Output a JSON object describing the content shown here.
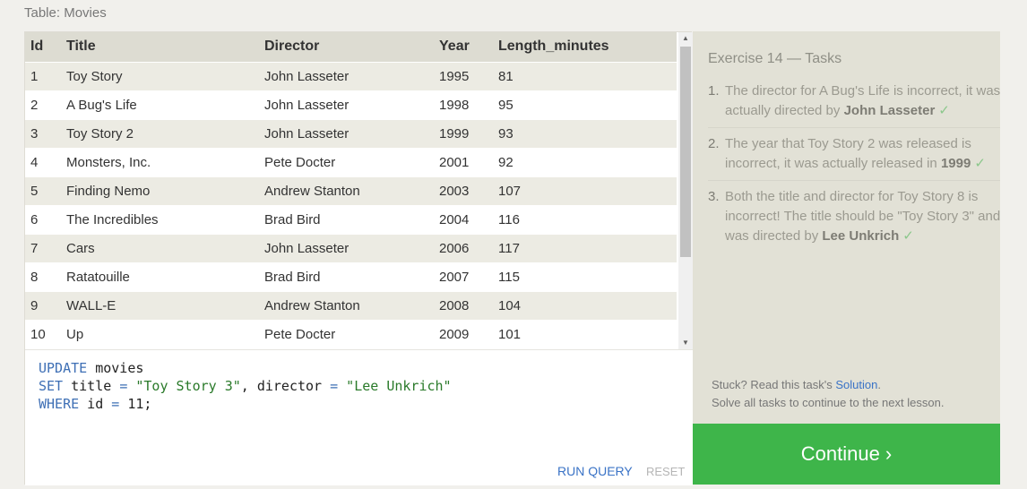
{
  "table_label": "Table: Movies",
  "columns": [
    "Id",
    "Title",
    "Director",
    "Year",
    "Length_minutes"
  ],
  "rows": [
    [
      "1",
      "Toy Story",
      "John Lasseter",
      "1995",
      "81"
    ],
    [
      "2",
      "A Bug's Life",
      "John Lasseter",
      "1998",
      "95"
    ],
    [
      "3",
      "Toy Story 2",
      "John Lasseter",
      "1999",
      "93"
    ],
    [
      "4",
      "Monsters, Inc.",
      "Pete Docter",
      "2001",
      "92"
    ],
    [
      "5",
      "Finding Nemo",
      "Andrew Stanton",
      "2003",
      "107"
    ],
    [
      "6",
      "The Incredibles",
      "Brad Bird",
      "2004",
      "116"
    ],
    [
      "7",
      "Cars",
      "John Lasseter",
      "2006",
      "117"
    ],
    [
      "8",
      "Ratatouille",
      "Brad Bird",
      "2007",
      "115"
    ],
    [
      "9",
      "WALL-E",
      "Andrew Stanton",
      "2008",
      "104"
    ],
    [
      "10",
      "Up",
      "Pete Docter",
      "2009",
      "101"
    ]
  ],
  "editor": {
    "line1_kw": "UPDATE",
    "line1_rest": " movies",
    "line2_kw": "SET",
    "line2_a": " title ",
    "line2_eq1": "=",
    "line2_str1": " \"Toy Story 3\"",
    "line2_b": ", director ",
    "line2_eq2": "=",
    "line2_str2": " \"Lee Unkrich\"",
    "line3_kw": "WHERE",
    "line3_a": " id ",
    "line3_eq": "=",
    "line3_b": " 11;",
    "run_label": "RUN QUERY",
    "reset_label": "RESET"
  },
  "exercise_title": "Exercise 14 — Tasks",
  "tasks": [
    {
      "num": "1.",
      "text": "The director for A Bug's Life is incorrect, it was actually directed by ",
      "bold": "John Lasseter",
      "after": "",
      "check": "✓"
    },
    {
      "num": "2.",
      "text": "The year that Toy Story 2 was released is incorrect, it was actually released in ",
      "bold": "1999",
      "after": "",
      "check": "✓"
    },
    {
      "num": "3.",
      "text": "Both the title and director for Toy Story 8 is incorrect! The title should be \"Toy Story 3\" and it was directed by ",
      "bold": "Lee Unkrich",
      "after": "",
      "check": "✓"
    }
  ],
  "stuck": {
    "prefix": "Stuck? Read this task's ",
    "link": "Solution",
    "suffix": ".",
    "line2": "Solve all tasks to continue to the next lesson."
  },
  "continue_label": "Continue ›",
  "icons": {
    "scroll_up": "▲",
    "scroll_down": "▼"
  }
}
